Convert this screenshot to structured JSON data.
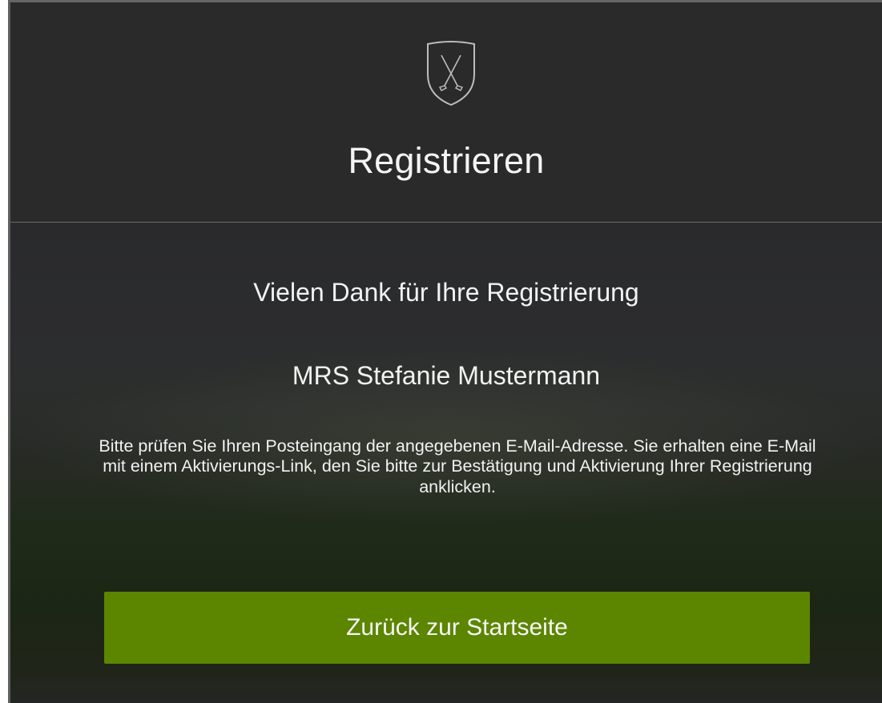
{
  "header": {
    "logo_icon": "golf-club-shield-icon",
    "title": "Registrieren"
  },
  "content": {
    "thanks_heading": "Vielen Dank für Ihre Registrierung",
    "user_name": "MRS Stefanie Mustermann",
    "info_text": "Bitte prüfen Sie Ihren Posteingang der angegebenen E-Mail-Adresse. Sie erhalten eine E-Mail mit einem Aktivierungs-Link, den Sie bitte zur Bestätigung und Aktivierung Ihrer Registrierung anklicken."
  },
  "actions": {
    "back_home_label": "Zurück zur Startseite"
  },
  "colors": {
    "button_bg": "#5c8500",
    "panel_bg": "#2a2a2b",
    "text": "#f2f2f2"
  }
}
